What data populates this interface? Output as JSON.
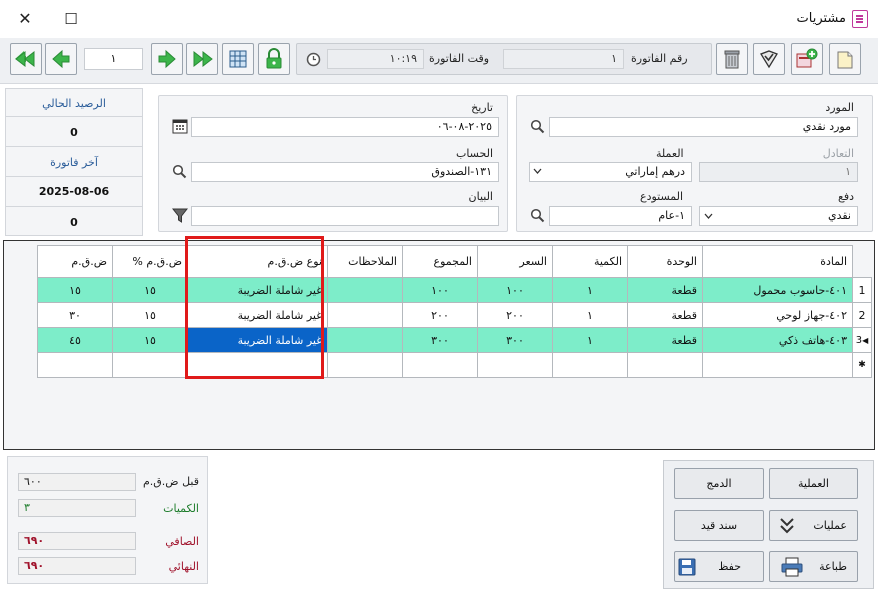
{
  "window": {
    "title": "مشتريات",
    "close_glyph": "✕",
    "maximize_glyph": "☐"
  },
  "toolbar": {
    "record_number": "١",
    "invoice_number_label": "رقم الفاتورة",
    "invoice_number": "١",
    "invoice_time_label": "وقت الفاتورة",
    "invoice_time": "١٠:١٩"
  },
  "supplier_panel": {
    "supplier_label": "المورد",
    "supplier_value": "مورد نقدي",
    "rate_label": "التعادل",
    "rate_value": "١",
    "currency_label": "العملة",
    "currency_value": "درهم إماراتي",
    "payment_label": "دفع",
    "payment_value": "نقدي",
    "warehouse_label": "المستودع",
    "warehouse_value": "١-عام"
  },
  "date_panel": {
    "date_label": "تاريخ",
    "date_value": "٢٠٢٥-٠٨-٠٦",
    "account_label": "الحساب",
    "account_value": "١٣١-الصندوق",
    "statement_label": "البيان",
    "statement_value": ""
  },
  "side_panel": {
    "balance_label": "الرصيد الحالي",
    "balance_value": "0",
    "last_invoice_label": "آخر فاتورة",
    "last_invoice_date": "2025-08-06",
    "last_invoice_value": "0"
  },
  "grid": {
    "headers": {
      "vat": "ض.ق.م",
      "vat_percent": "ض.ق.م %",
      "vat_type": "نوع ض.ق.م",
      "notes": "الملاحظات",
      "total": "المجموع",
      "price": "السعر",
      "qty": "الكمية",
      "unit": "الوحدة",
      "item": "المادة"
    },
    "rows": [
      {
        "num": "1",
        "item": "٤٠١-حاسوب محمول",
        "unit": "قطعة",
        "qty": "١",
        "price": "١٠٠",
        "total": "١٠٠",
        "notes": "",
        "vat_type": "غير شاملة الضريبة",
        "vat_percent": "١٥",
        "vat": "١٥"
      },
      {
        "num": "2",
        "item": "٤٠٢-جهاز لوحي",
        "unit": "قطعة",
        "qty": "١",
        "price": "٢٠٠",
        "total": "٢٠٠",
        "notes": "",
        "vat_type": "غير شاملة الضريبة",
        "vat_percent": "١٥",
        "vat": "٣٠"
      },
      {
        "num": "3",
        "item": "٤٠٣-هاتف ذكي",
        "unit": "قطعة",
        "qty": "١",
        "price": "٣٠٠",
        "total": "٣٠٠",
        "notes": "",
        "vat_type": "غير شاملة الضريبة",
        "vat_percent": "١٥",
        "vat": "٤٥"
      }
    ],
    "new_row_marker": "✱",
    "current_row_marker": "◀"
  },
  "summary": {
    "before_vat_label": "قبل ض.ق.م",
    "before_vat_value": "٦٠٠",
    "quantities_label": "الكميات",
    "quantities_value": "٣",
    "net_label": "الصافي",
    "net_value": "٦٩٠",
    "final_label": "النهائي",
    "final_value": "٦٩٠"
  },
  "actions": {
    "operation": "العملية",
    "merge": "الدمج",
    "operations": "عمليات",
    "journal": "سند قيد",
    "print": "طباعة",
    "save": "حفظ"
  },
  "colors": {
    "highlight_row": "#7dedc9",
    "selected_cell": "#0a64c8",
    "annotation_box": "#e01a1a",
    "nav_green": "#3cb54a"
  }
}
